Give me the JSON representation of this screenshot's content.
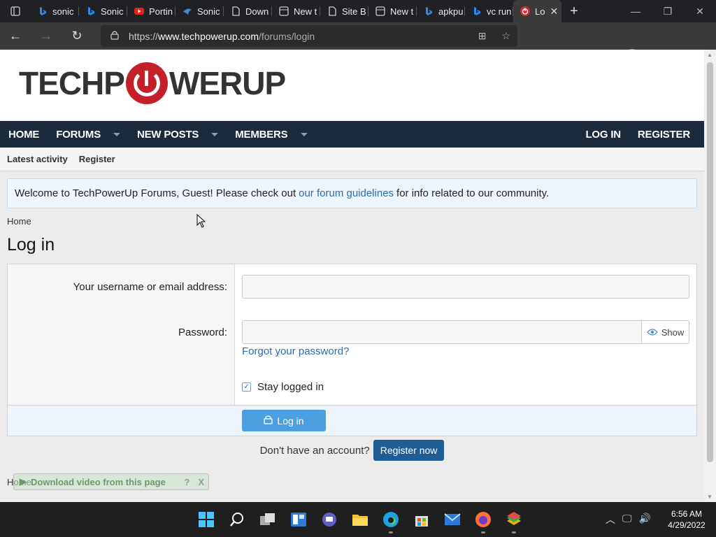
{
  "browser": {
    "tabs": [
      {
        "label": "",
        "icon": "tab-actions-icon"
      },
      {
        "label": "sonic",
        "icon": "bing-icon"
      },
      {
        "label": "Sonic",
        "icon": "bing-icon"
      },
      {
        "label": "Portin",
        "icon": "youtube-icon"
      },
      {
        "label": "Sonic",
        "icon": "tab-generic-icon"
      },
      {
        "label": "Down",
        "icon": "page-icon"
      },
      {
        "label": "New t",
        "icon": "newtab-icon"
      },
      {
        "label": "Site B",
        "icon": "page-icon"
      },
      {
        "label": "New t",
        "icon": "newtab-icon"
      },
      {
        "label": "apkpu",
        "icon": "bing-icon"
      },
      {
        "label": "vc run",
        "icon": "bing-icon"
      },
      {
        "label": "Lo",
        "icon": "techpowerup-icon",
        "active": true
      }
    ],
    "url_prefix": "https://",
    "url_host": "www.techpowerup.com",
    "url_path": "/forums/login"
  },
  "site": {
    "logo_left": "TECHP",
    "logo_right": "WERUP",
    "nav": {
      "home": "HOME",
      "forums": "FORUMS",
      "new_posts": "NEW POSTS",
      "members": "MEMBERS",
      "log_in": "LOG IN",
      "register": "REGISTER"
    },
    "subnav": {
      "latest": "Latest activity",
      "register": "Register"
    },
    "notice": {
      "before": "Welcome to TechPowerUp Forums, Guest! Please check out",
      "link": "our forum guidelines",
      "after": "for info related to our community."
    },
    "breadcrumb": "Home",
    "page_title": "Log in"
  },
  "form": {
    "username_label": "Your username or email address:",
    "username_value": "",
    "password_label": "Password:",
    "password_value": "",
    "show_label": "Show",
    "forgot": "Forgot your password?",
    "stay_label": "Stay logged in",
    "stay_checked": true,
    "login_button": "Log in"
  },
  "register_prompt": "Don't have an account?",
  "register_button": "Register now",
  "footer_breadcrumb": "Home",
  "download_overlay": {
    "label": "Download video from this page",
    "help": "?",
    "close": "X"
  },
  "taskbar": {
    "time": "6:56 AM",
    "date": "4/29/2022"
  },
  "colors": {
    "nav_bg": "#1c2b3b",
    "link": "#2a6cb0",
    "login_btn": "#4ca0e0",
    "register_btn": "#1f5e95",
    "logo_red": "#c3202a"
  }
}
